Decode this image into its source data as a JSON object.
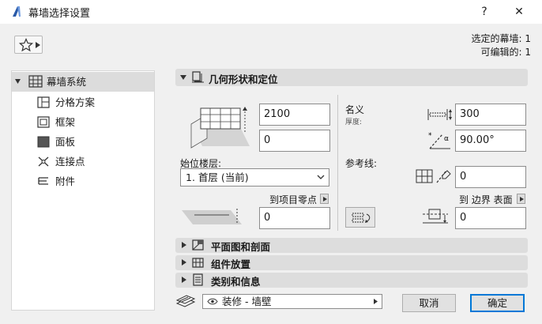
{
  "window": {
    "title": "幕墙选择设置",
    "help_label": "?",
    "close_label": "✕"
  },
  "selection_info": {
    "selected": "选定的幕墙: 1",
    "editable": "可编辑的: 1"
  },
  "sidebar": {
    "items": [
      {
        "label": "幕墙系统",
        "icon": "grid-icon",
        "selected": true
      },
      {
        "label": "分格方案",
        "icon": "panel-scheme-icon"
      },
      {
        "label": "框架",
        "icon": "frame-icon"
      },
      {
        "label": "面板",
        "icon": "panel-icon"
      },
      {
        "label": "连接点",
        "icon": "junction-icon"
      },
      {
        "label": "附件",
        "icon": "accessory-icon"
      }
    ]
  },
  "sections": {
    "geometry": {
      "label": "几何形状和定位",
      "expanded": true
    },
    "floor_plan": {
      "label": "平面图和剖面"
    },
    "component": {
      "label": "组件放置"
    },
    "category": {
      "label": "类别和信息"
    }
  },
  "geometry": {
    "height_value": "2100",
    "offset_value": "0",
    "home_story_label": "始位楼层:",
    "home_story_value": "1. 首层 (当前)",
    "to_project_zero_label": "到项目零点",
    "project_zero_value": "0",
    "nominal_label": "名义",
    "thickness_label": "厚度:",
    "thickness_value": "300",
    "angle_value": "90.00°",
    "reference_line_label": "参考线:",
    "reference_offset_value": "0",
    "to_boundary_label": "到 边界 表面",
    "boundary_offset_value": "0"
  },
  "footer": {
    "layer_value": "装修 - 墙壁",
    "cancel_label": "取消",
    "ok_label": "确定"
  },
  "colors": {
    "accent": "#0078d7",
    "panel_bg": "#f0f0f0",
    "header_bg": "#dddddd"
  }
}
